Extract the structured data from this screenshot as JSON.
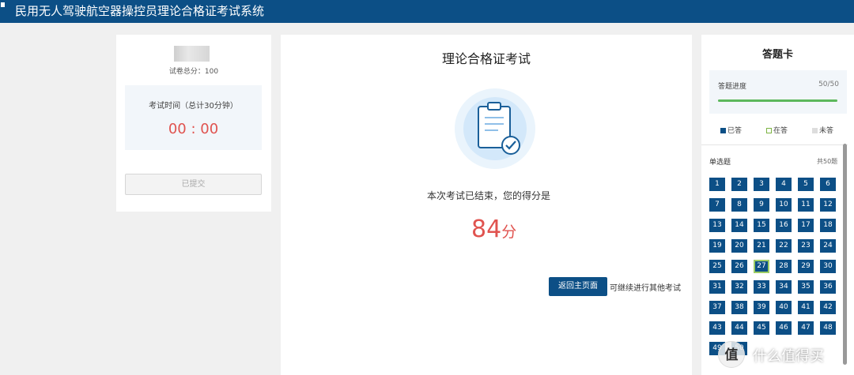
{
  "header": {
    "title": "民用无人驾驶航空器操控员理论合格证考试系统"
  },
  "left": {
    "total_score": "试卷总分：100",
    "timer_label": "考试时间（总计30分钟）",
    "timer_value": "00 : 00",
    "submitted_label": "已提交"
  },
  "center": {
    "title": "理论合格证考试",
    "result_message": "本次考试已结束，您的得分是",
    "score_value": "84",
    "score_unit": "分",
    "home_button": "返回主页面",
    "continue_text": "可继续进行其他考试"
  },
  "answer_card": {
    "title": "答题卡",
    "progress_label": "答题进度",
    "progress_count": "50/50",
    "progress_fraction": 1.0,
    "legend": {
      "answered": "已答",
      "current": "在答",
      "unanswered": "未答"
    },
    "section_name": "单选题",
    "section_count": "共50题",
    "current_question": 27,
    "questions": [
      "1",
      "2",
      "3",
      "4",
      "5",
      "6",
      "7",
      "8",
      "9",
      "10",
      "11",
      "12",
      "13",
      "14",
      "15",
      "16",
      "17",
      "18",
      "19",
      "20",
      "21",
      "22",
      "23",
      "24",
      "25",
      "26",
      "27",
      "28",
      "29",
      "30",
      "31",
      "32",
      "33",
      "34",
      "35",
      "36",
      "37",
      "38",
      "39",
      "40",
      "41",
      "42",
      "43",
      "44",
      "45",
      "46",
      "47",
      "48",
      "49",
      "50"
    ]
  },
  "colors": {
    "primary": "#0c4f86",
    "accent_red": "#e0534f",
    "progress_green": "#5cb85c",
    "current_border": "#9ccc65"
  },
  "watermark": {
    "logo_char": "值",
    "text": "什么值得买"
  }
}
